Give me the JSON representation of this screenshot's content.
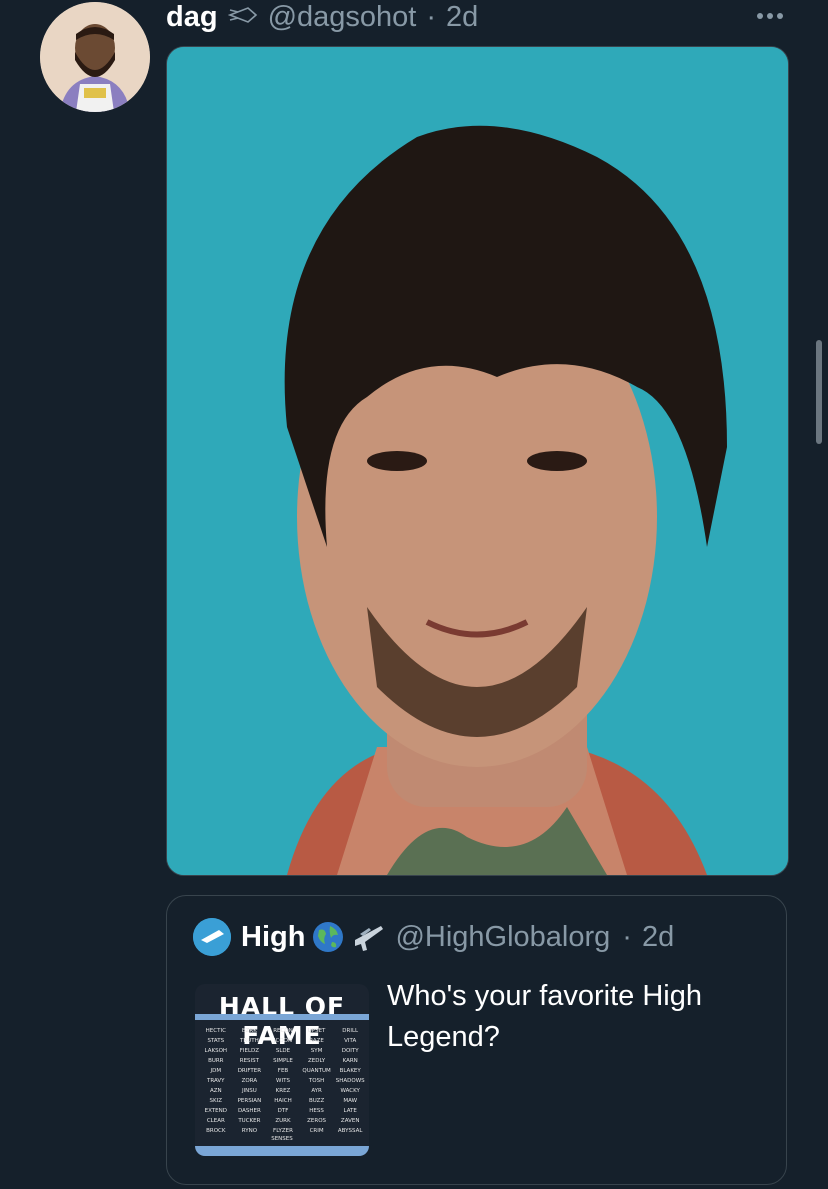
{
  "tweet": {
    "display_name": "dag",
    "handle": "@dagsohot",
    "separator": "·",
    "time": "2d",
    "media_alt_icon": "portrait-photo"
  },
  "quote": {
    "display_name": "High",
    "handle": "@HighGlobalorg",
    "separator": "·",
    "time": "2d",
    "text": "Who's your favorite High Legend?",
    "thumbnail": {
      "title": "HALL OF FAME",
      "names": [
        "HECTIC",
        "BZRK",
        "RECON",
        "UPSET",
        "DRILL",
        "STATS",
        "TRUTH",
        "JCOON",
        "RAZE",
        "VITA",
        "LAKSOH",
        "FIELDZ",
        "SLDE",
        "SYM",
        "DOITY",
        "BURR",
        "RESIST",
        "SIMPLE",
        "ZEDLY",
        "KARN",
        "JDM",
        "DRIFTER",
        "FEB",
        "QUANTUM",
        "BLAKEY",
        "TRAVY",
        "ZORA",
        "WITS",
        "TOSH",
        "SHADOWS",
        "AZN",
        "JINSU",
        "KREZ",
        "AYR",
        "WACKY",
        "SKIZ",
        "PERSIAN",
        "HAICH",
        "BUZZ",
        "MAW",
        "EXTEND",
        "DASHER",
        "DTF",
        "HESS",
        "LATE",
        "CLEAR",
        "TUCKER",
        "ZURK",
        "ZEROS",
        "ZAVEN",
        "BROCK",
        "RYNO",
        "FLYZER",
        "CRIM",
        "ABYSSAL"
      ],
      "last": "SENSES"
    }
  },
  "colors": {
    "background": "#15202b",
    "muted": "#8899a6",
    "border": "#38444d",
    "photo_background": "#2fa7b8"
  }
}
